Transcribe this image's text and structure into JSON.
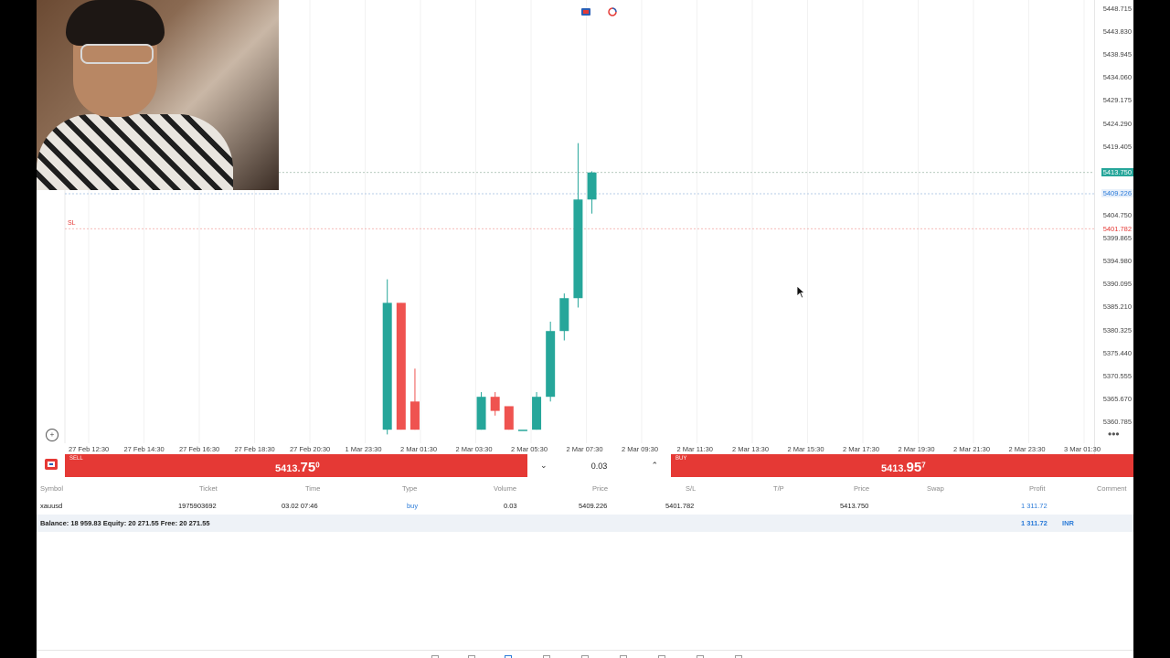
{
  "price_axis": [
    "5448.715",
    "5443.830",
    "5438.945",
    "5434.060",
    "5429.175",
    "5424.290",
    "5419.405",
    "5404.750",
    "5399.865",
    "5394.980",
    "5390.095",
    "5385.210",
    "5380.325",
    "5375.440",
    "5370.555",
    "5365.670",
    "5360.785"
  ],
  "price_tags": {
    "current": "5413.750",
    "entry": "5409.226",
    "stop_loss": "5401.782"
  },
  "sl_label": "SL",
  "time_axis": [
    "27 Feb 12:30",
    "27 Feb 14:30",
    "27 Feb 16:30",
    "27 Feb 18:30",
    "27 Feb 20:30",
    "1 Mar 23:30",
    "2 Mar 01:30",
    "2 Mar 03:30",
    "2 Mar 05:30",
    "2 Mar 07:30",
    "2 Mar 09:30",
    "2 Mar 11:30",
    "2 Mar 13:30",
    "2 Mar 15:30",
    "2 Mar 17:30",
    "2 Mar 19:30",
    "2 Mar 21:30",
    "2 Mar 23:30",
    "3 Mar 01:30"
  ],
  "candles": [
    {
      "time_index": 5.4,
      "open": 5359,
      "high": 5391,
      "low": 5358,
      "close": 5386
    },
    {
      "time_index": 5.65,
      "open": 5386,
      "high": 5386,
      "low": 5359,
      "close": 5359
    },
    {
      "time_index": 5.9,
      "open": 5365,
      "high": 5372,
      "low": 5359,
      "close": 5359
    },
    {
      "time_index": 7.1,
      "open": 5359,
      "high": 5367,
      "low": 5359,
      "close": 5366
    },
    {
      "time_index": 7.35,
      "open": 5366,
      "high": 5367,
      "low": 5362,
      "close": 5363
    },
    {
      "time_index": 7.6,
      "open": 5364,
      "high": 5364,
      "low": 5359,
      "close": 5359
    },
    {
      "time_index": 7.85,
      "open": 5359,
      "high": 5359,
      "low": 5359,
      "close": 5359
    },
    {
      "time_index": 8.1,
      "open": 5359,
      "high": 5367,
      "low": 5359,
      "close": 5366
    },
    {
      "time_index": 8.35,
      "open": 5366,
      "high": 5382,
      "low": 5365,
      "close": 5380
    },
    {
      "time_index": 8.6,
      "open": 5380,
      "high": 5388,
      "low": 5378,
      "close": 5387
    },
    {
      "time_index": 8.85,
      "open": 5387,
      "high": 5420,
      "low": 5385,
      "close": 5408
    },
    {
      "time_index": 9.1,
      "open": 5408,
      "high": 5414,
      "low": 5405,
      "close": 5413.75
    }
  ],
  "colors": {
    "bull": "#26a69a",
    "bear": "#ef5350",
    "sell": "#e53935",
    "buy": "#e53935",
    "link": "#2b7bd8"
  },
  "trade": {
    "sell_label": "SELL",
    "sell_price_main": "5413.",
    "sell_price_big": "75",
    "sell_price_sup": "0",
    "buy_label": "BUY",
    "buy_price_main": "5413.",
    "buy_price_big": "95",
    "buy_price_sup": "7",
    "volume": "0.03"
  },
  "positions": {
    "headers": {
      "symbol": "Symbol",
      "ticket": "Ticket",
      "time": "Time",
      "type": "Type",
      "volume": "Volume",
      "price": "Price",
      "sl": "S/L",
      "tp": "T/P",
      "cur_price": "Price",
      "swap": "Swap",
      "profit": "Profit",
      "comment": "Comment"
    },
    "row": {
      "symbol": "xauusd",
      "ticket": "1975903692",
      "time": "03.02 07:46",
      "type": "buy",
      "volume": "0.03",
      "price": "5409.226",
      "sl": "5401.782",
      "tp": "",
      "cur_price": "5413.750",
      "swap": "",
      "profit": "1 311.72",
      "comment": ""
    },
    "balance_text": "Balance: 18 959.83 Equity: 20 271.55 Free: 20 271.55",
    "total_profit": "1 311.72",
    "currency": "INR"
  }
}
